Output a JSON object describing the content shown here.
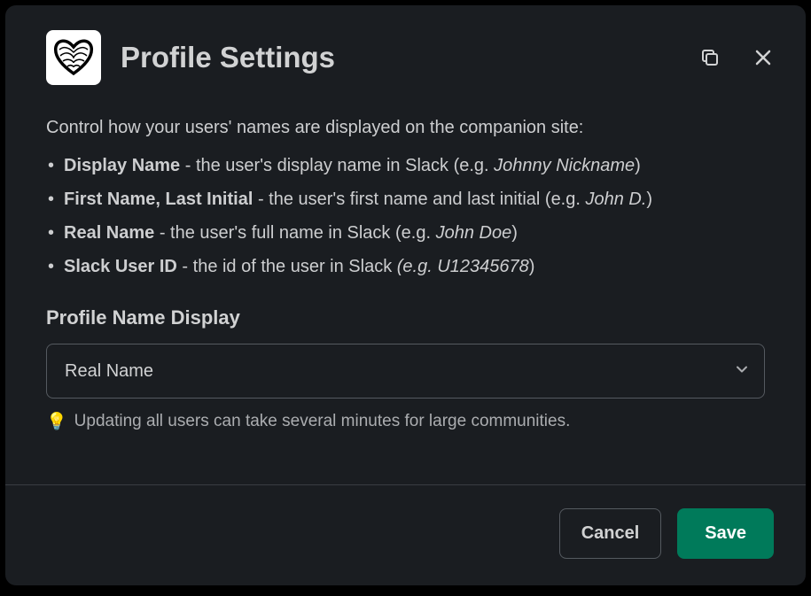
{
  "header": {
    "title": "Profile Settings"
  },
  "intro": "Control how your users' names are displayed on the companion site:",
  "bullets": [
    {
      "bold": "Display Name",
      "rest": " - the user's display name in Slack (e.g. ",
      "italic": "Johnny Nickname",
      "close": ")"
    },
    {
      "bold": "First Name, Last Initial",
      "rest": " - the user's first name and last initial (e.g. ",
      "italic": "John D.",
      "close": ")"
    },
    {
      "bold": "Real Name",
      "rest": " - the user's full name in Slack (e.g. ",
      "italic": "John Doe",
      "close": ")"
    },
    {
      "bold": "Slack User ID",
      "rest": " - the id of the user in Slack ",
      "italic": "(e.g. U12345678",
      "close": ")"
    }
  ],
  "field": {
    "label": "Profile Name Display",
    "selected": "Real Name"
  },
  "hint": {
    "icon": "💡",
    "text": "Updating all users can take several minutes for large communities."
  },
  "footer": {
    "cancel": "Cancel",
    "save": "Save"
  }
}
